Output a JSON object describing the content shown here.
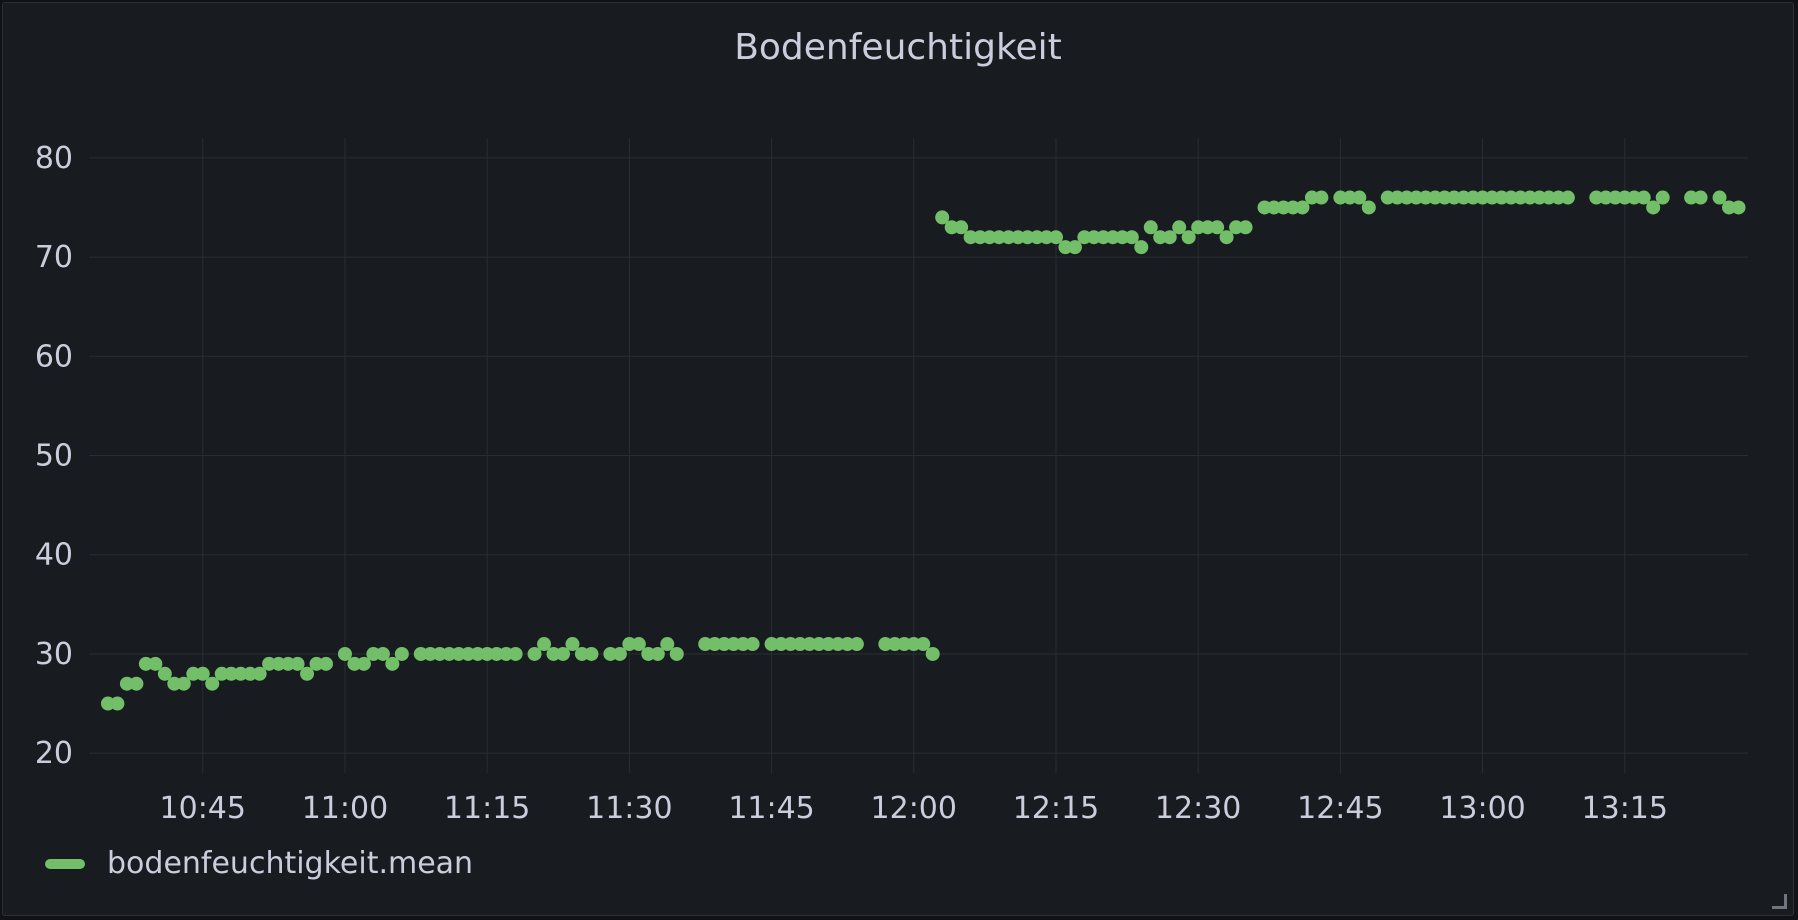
{
  "chart_data": {
    "type": "scatter",
    "title": "Bodenfeuchtigkeit",
    "xlabel": "",
    "ylabel": "",
    "x_ticks": [
      "10:45",
      "11:00",
      "11:15",
      "11:30",
      "11:45",
      "12:00",
      "12:15",
      "12:30",
      "12:45",
      "13:00",
      "13:15"
    ],
    "y_ticks": [
      20,
      30,
      40,
      50,
      60,
      70,
      80
    ],
    "ylim": [
      18,
      82
    ],
    "xlim": [
      "10:33",
      "13:28"
    ],
    "grid": true,
    "legend_position": "bottom-left",
    "series": [
      {
        "name": "bodenfeuchtigkeit.mean",
        "color": "#73bf69",
        "points": [
          [
            "10:35",
            25
          ],
          [
            "10:36",
            25
          ],
          [
            "10:37",
            27
          ],
          [
            "10:38",
            27
          ],
          [
            "10:39",
            29
          ],
          [
            "10:40",
            29
          ],
          [
            "10:41",
            28
          ],
          [
            "10:42",
            27
          ],
          [
            "10:43",
            27
          ],
          [
            "10:44",
            28
          ],
          [
            "10:45",
            28
          ],
          [
            "10:46",
            27
          ],
          [
            "10:47",
            28
          ],
          [
            "10:48",
            28
          ],
          [
            "10:49",
            28
          ],
          [
            "10:50",
            28
          ],
          [
            "10:51",
            28
          ],
          [
            "10:52",
            29
          ],
          [
            "10:53",
            29
          ],
          [
            "10:54",
            29
          ],
          [
            "10:55",
            29
          ],
          [
            "10:56",
            28
          ],
          [
            "10:57",
            29
          ],
          [
            "10:58",
            29
          ],
          [
            "11:00",
            30
          ],
          [
            "11:01",
            29
          ],
          [
            "11:02",
            29
          ],
          [
            "11:03",
            30
          ],
          [
            "11:04",
            30
          ],
          [
            "11:05",
            29
          ],
          [
            "11:06",
            30
          ],
          [
            "11:08",
            30
          ],
          [
            "11:09",
            30
          ],
          [
            "11:10",
            30
          ],
          [
            "11:11",
            30
          ],
          [
            "11:12",
            30
          ],
          [
            "11:13",
            30
          ],
          [
            "11:14",
            30
          ],
          [
            "11:15",
            30
          ],
          [
            "11:16",
            30
          ],
          [
            "11:17",
            30
          ],
          [
            "11:18",
            30
          ],
          [
            "11:20",
            30
          ],
          [
            "11:21",
            31
          ],
          [
            "11:22",
            30
          ],
          [
            "11:23",
            30
          ],
          [
            "11:24",
            31
          ],
          [
            "11:25",
            30
          ],
          [
            "11:26",
            30
          ],
          [
            "11:28",
            30
          ],
          [
            "11:29",
            30
          ],
          [
            "11:30",
            31
          ],
          [
            "11:31",
            31
          ],
          [
            "11:32",
            30
          ],
          [
            "11:33",
            30
          ],
          [
            "11:34",
            31
          ],
          [
            "11:35",
            30
          ],
          [
            "11:38",
            31
          ],
          [
            "11:39",
            31
          ],
          [
            "11:40",
            31
          ],
          [
            "11:41",
            31
          ],
          [
            "11:42",
            31
          ],
          [
            "11:43",
            31
          ],
          [
            "11:45",
            31
          ],
          [
            "11:46",
            31
          ],
          [
            "11:47",
            31
          ],
          [
            "11:48",
            31
          ],
          [
            "11:49",
            31
          ],
          [
            "11:50",
            31
          ],
          [
            "11:51",
            31
          ],
          [
            "11:52",
            31
          ],
          [
            "11:53",
            31
          ],
          [
            "11:54",
            31
          ],
          [
            "11:57",
            31
          ],
          [
            "11:58",
            31
          ],
          [
            "11:59",
            31
          ],
          [
            "12:00",
            31
          ],
          [
            "12:01",
            31
          ],
          [
            "12:02",
            30
          ],
          [
            "12:03",
            74
          ],
          [
            "12:04",
            73
          ],
          [
            "12:05",
            73
          ],
          [
            "12:06",
            72
          ],
          [
            "12:07",
            72
          ],
          [
            "12:08",
            72
          ],
          [
            "12:09",
            72
          ],
          [
            "12:10",
            72
          ],
          [
            "12:11",
            72
          ],
          [
            "12:12",
            72
          ],
          [
            "12:13",
            72
          ],
          [
            "12:14",
            72
          ],
          [
            "12:15",
            72
          ],
          [
            "12:16",
            71
          ],
          [
            "12:17",
            71
          ],
          [
            "12:18",
            72
          ],
          [
            "12:19",
            72
          ],
          [
            "12:20",
            72
          ],
          [
            "12:21",
            72
          ],
          [
            "12:22",
            72
          ],
          [
            "12:23",
            72
          ],
          [
            "12:24",
            71
          ],
          [
            "12:25",
            73
          ],
          [
            "12:26",
            72
          ],
          [
            "12:27",
            72
          ],
          [
            "12:28",
            73
          ],
          [
            "12:29",
            72
          ],
          [
            "12:30",
            73
          ],
          [
            "12:31",
            73
          ],
          [
            "12:32",
            73
          ],
          [
            "12:33",
            72
          ],
          [
            "12:34",
            73
          ],
          [
            "12:35",
            73
          ],
          [
            "12:37",
            75
          ],
          [
            "12:38",
            75
          ],
          [
            "12:39",
            75
          ],
          [
            "12:40",
            75
          ],
          [
            "12:41",
            75
          ],
          [
            "12:42",
            76
          ],
          [
            "12:43",
            76
          ],
          [
            "12:45",
            76
          ],
          [
            "12:46",
            76
          ],
          [
            "12:47",
            76
          ],
          [
            "12:48",
            75
          ],
          [
            "12:50",
            76
          ],
          [
            "12:51",
            76
          ],
          [
            "12:52",
            76
          ],
          [
            "12:53",
            76
          ],
          [
            "12:54",
            76
          ],
          [
            "12:55",
            76
          ],
          [
            "12:56",
            76
          ],
          [
            "12:57",
            76
          ],
          [
            "12:58",
            76
          ],
          [
            "12:59",
            76
          ],
          [
            "13:00",
            76
          ],
          [
            "13:01",
            76
          ],
          [
            "13:02",
            76
          ],
          [
            "13:03",
            76
          ],
          [
            "13:04",
            76
          ],
          [
            "13:05",
            76
          ],
          [
            "13:06",
            76
          ],
          [
            "13:07",
            76
          ],
          [
            "13:08",
            76
          ],
          [
            "13:09",
            76
          ],
          [
            "13:12",
            76
          ],
          [
            "13:13",
            76
          ],
          [
            "13:14",
            76
          ],
          [
            "13:15",
            76
          ],
          [
            "13:16",
            76
          ],
          [
            "13:17",
            76
          ],
          [
            "13:18",
            75
          ],
          [
            "13:19",
            76
          ],
          [
            "13:22",
            76
          ],
          [
            "13:23",
            76
          ],
          [
            "13:25",
            76
          ],
          [
            "13:26",
            75
          ],
          [
            "13:27",
            75
          ]
        ]
      }
    ]
  },
  "legend": {
    "label": "bodenfeuchtigkeit.mean",
    "color": "#73bf69"
  }
}
